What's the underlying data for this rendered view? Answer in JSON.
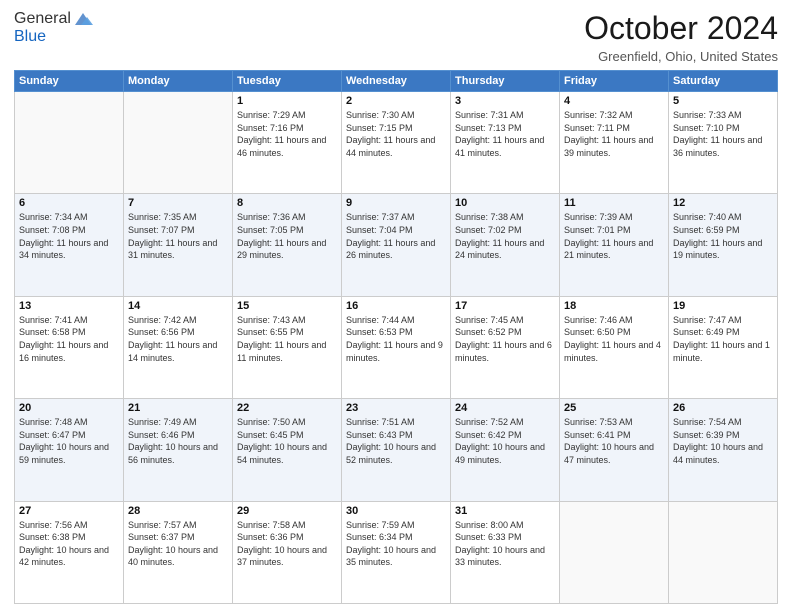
{
  "header": {
    "logo_general": "General",
    "logo_blue": "Blue",
    "month_title": "October 2024",
    "location": "Greenfield, Ohio, United States"
  },
  "days_of_week": [
    "Sunday",
    "Monday",
    "Tuesday",
    "Wednesday",
    "Thursday",
    "Friday",
    "Saturday"
  ],
  "weeks": [
    [
      {
        "day": "",
        "info": ""
      },
      {
        "day": "",
        "info": ""
      },
      {
        "day": "1",
        "info": "Sunrise: 7:29 AM\nSunset: 7:16 PM\nDaylight: 11 hours and 46 minutes."
      },
      {
        "day": "2",
        "info": "Sunrise: 7:30 AM\nSunset: 7:15 PM\nDaylight: 11 hours and 44 minutes."
      },
      {
        "day": "3",
        "info": "Sunrise: 7:31 AM\nSunset: 7:13 PM\nDaylight: 11 hours and 41 minutes."
      },
      {
        "day": "4",
        "info": "Sunrise: 7:32 AM\nSunset: 7:11 PM\nDaylight: 11 hours and 39 minutes."
      },
      {
        "day": "5",
        "info": "Sunrise: 7:33 AM\nSunset: 7:10 PM\nDaylight: 11 hours and 36 minutes."
      }
    ],
    [
      {
        "day": "6",
        "info": "Sunrise: 7:34 AM\nSunset: 7:08 PM\nDaylight: 11 hours and 34 minutes."
      },
      {
        "day": "7",
        "info": "Sunrise: 7:35 AM\nSunset: 7:07 PM\nDaylight: 11 hours and 31 minutes."
      },
      {
        "day": "8",
        "info": "Sunrise: 7:36 AM\nSunset: 7:05 PM\nDaylight: 11 hours and 29 minutes."
      },
      {
        "day": "9",
        "info": "Sunrise: 7:37 AM\nSunset: 7:04 PM\nDaylight: 11 hours and 26 minutes."
      },
      {
        "day": "10",
        "info": "Sunrise: 7:38 AM\nSunset: 7:02 PM\nDaylight: 11 hours and 24 minutes."
      },
      {
        "day": "11",
        "info": "Sunrise: 7:39 AM\nSunset: 7:01 PM\nDaylight: 11 hours and 21 minutes."
      },
      {
        "day": "12",
        "info": "Sunrise: 7:40 AM\nSunset: 6:59 PM\nDaylight: 11 hours and 19 minutes."
      }
    ],
    [
      {
        "day": "13",
        "info": "Sunrise: 7:41 AM\nSunset: 6:58 PM\nDaylight: 11 hours and 16 minutes."
      },
      {
        "day": "14",
        "info": "Sunrise: 7:42 AM\nSunset: 6:56 PM\nDaylight: 11 hours and 14 minutes."
      },
      {
        "day": "15",
        "info": "Sunrise: 7:43 AM\nSunset: 6:55 PM\nDaylight: 11 hours and 11 minutes."
      },
      {
        "day": "16",
        "info": "Sunrise: 7:44 AM\nSunset: 6:53 PM\nDaylight: 11 hours and 9 minutes."
      },
      {
        "day": "17",
        "info": "Sunrise: 7:45 AM\nSunset: 6:52 PM\nDaylight: 11 hours and 6 minutes."
      },
      {
        "day": "18",
        "info": "Sunrise: 7:46 AM\nSunset: 6:50 PM\nDaylight: 11 hours and 4 minutes."
      },
      {
        "day": "19",
        "info": "Sunrise: 7:47 AM\nSunset: 6:49 PM\nDaylight: 11 hours and 1 minute."
      }
    ],
    [
      {
        "day": "20",
        "info": "Sunrise: 7:48 AM\nSunset: 6:47 PM\nDaylight: 10 hours and 59 minutes."
      },
      {
        "day": "21",
        "info": "Sunrise: 7:49 AM\nSunset: 6:46 PM\nDaylight: 10 hours and 56 minutes."
      },
      {
        "day": "22",
        "info": "Sunrise: 7:50 AM\nSunset: 6:45 PM\nDaylight: 10 hours and 54 minutes."
      },
      {
        "day": "23",
        "info": "Sunrise: 7:51 AM\nSunset: 6:43 PM\nDaylight: 10 hours and 52 minutes."
      },
      {
        "day": "24",
        "info": "Sunrise: 7:52 AM\nSunset: 6:42 PM\nDaylight: 10 hours and 49 minutes."
      },
      {
        "day": "25",
        "info": "Sunrise: 7:53 AM\nSunset: 6:41 PM\nDaylight: 10 hours and 47 minutes."
      },
      {
        "day": "26",
        "info": "Sunrise: 7:54 AM\nSunset: 6:39 PM\nDaylight: 10 hours and 44 minutes."
      }
    ],
    [
      {
        "day": "27",
        "info": "Sunrise: 7:56 AM\nSunset: 6:38 PM\nDaylight: 10 hours and 42 minutes."
      },
      {
        "day": "28",
        "info": "Sunrise: 7:57 AM\nSunset: 6:37 PM\nDaylight: 10 hours and 40 minutes."
      },
      {
        "day": "29",
        "info": "Sunrise: 7:58 AM\nSunset: 6:36 PM\nDaylight: 10 hours and 37 minutes."
      },
      {
        "day": "30",
        "info": "Sunrise: 7:59 AM\nSunset: 6:34 PM\nDaylight: 10 hours and 35 minutes."
      },
      {
        "day": "31",
        "info": "Sunrise: 8:00 AM\nSunset: 6:33 PM\nDaylight: 10 hours and 33 minutes."
      },
      {
        "day": "",
        "info": ""
      },
      {
        "day": "",
        "info": ""
      }
    ]
  ]
}
